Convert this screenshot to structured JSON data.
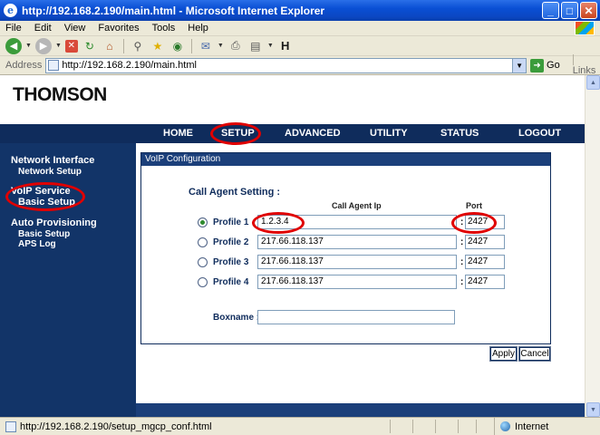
{
  "window": {
    "title": "http://192.168.2.190/main.html - Microsoft Internet Explorer",
    "logo_glyph": "e",
    "buttons": {
      "minimize": "_",
      "maximize": "□",
      "close": "✕"
    }
  },
  "menubar": {
    "items": [
      "File",
      "Edit",
      "View",
      "Favorites",
      "Tools",
      "Help"
    ]
  },
  "toolbar": {
    "icons": [
      "back-icon",
      "forward-icon",
      "stop-icon",
      "refresh-icon",
      "home-icon",
      "search-icon",
      "favorites-icon",
      "media-icon",
      "mail-icon",
      "print-icon",
      "edit-icon",
      "hh-icon"
    ],
    "hh_label": "H"
  },
  "address": {
    "label": "Address",
    "url": "http://192.168.2.190/main.html",
    "go_label": "Go",
    "links_label": "Links"
  },
  "page": {
    "brand": "THOMSON",
    "topnav": [
      "HOME",
      "SETUP",
      "ADVANCED",
      "UTILITY",
      "STATUS",
      "LOGOUT"
    ],
    "sidenav": {
      "network_interface": "Network Interface",
      "network_setup": "Network Setup",
      "voip_service": "VoIP Service",
      "basic_setup": "Basic Setup",
      "auto_provisioning": "Auto Provisioning",
      "ap_basic_setup": "Basic Setup",
      "aps_log": "APS Log"
    },
    "panel": {
      "title": "VoIP Configuration",
      "section_title": "Call Agent Setting :",
      "col_ip": "Call Agent Ip",
      "col_port": "Port",
      "profiles": [
        {
          "label": "Profile 1",
          "ip": "1.2.3.4",
          "port": "2427",
          "selected": true
        },
        {
          "label": "Profile 2",
          "ip": "217.66.118.137",
          "port": "2427",
          "selected": false
        },
        {
          "label": "Profile 3",
          "ip": "217.66.118.137",
          "port": "2427",
          "selected": false
        },
        {
          "label": "Profile 4",
          "ip": "217.66.118.137",
          "port": "2427",
          "selected": false
        }
      ],
      "colon": ":",
      "boxname_label": "Boxname :",
      "boxname_value": ""
    },
    "buttons": {
      "apply": "Apply",
      "cancel": "Cancel"
    }
  },
  "status": {
    "url": "http://192.168.2.190/setup_mgcp_conf.html",
    "zone": "Internet"
  },
  "colors": {
    "nav_bg": "#0f2c5c",
    "highlight_circle": "#e00000"
  }
}
